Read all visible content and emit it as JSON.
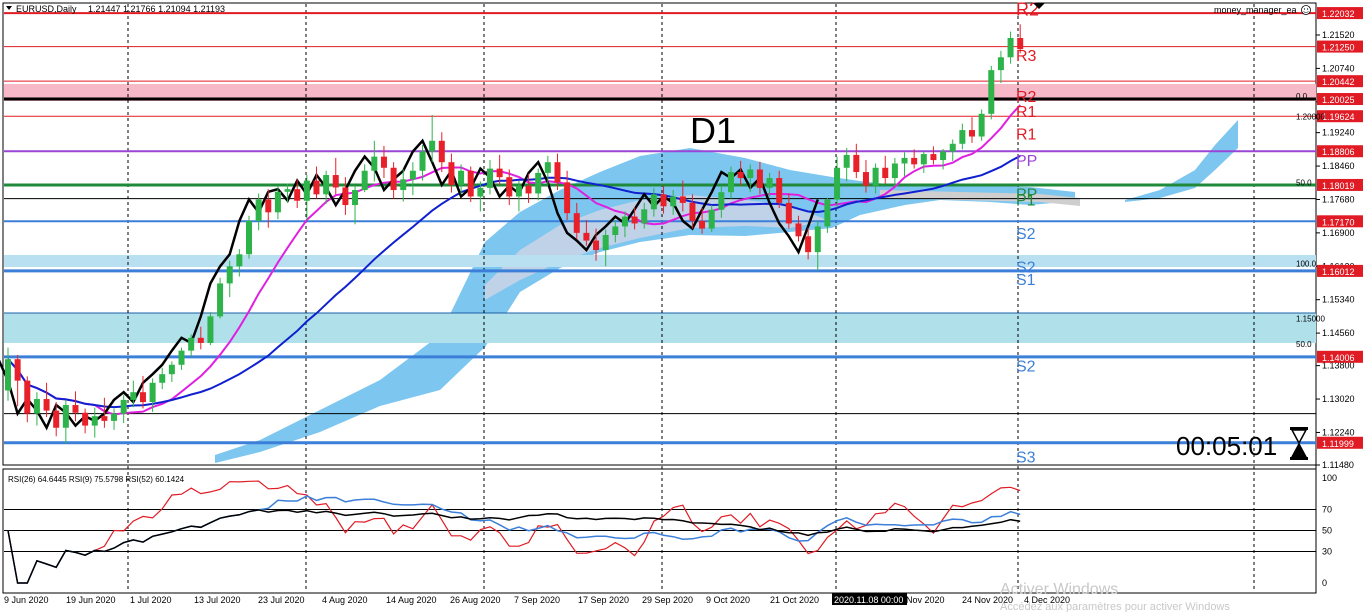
{
  "header": {
    "symbol": "EURUSD,Daily",
    "ohlc": "1.21447 1.21766 1.21094 1.21193",
    "ea_name": "money_manager_ea"
  },
  "timer": "00:05:01",
  "chart_title": "D1",
  "watermark": {
    "line1": "Activer Windows",
    "line2": "Accédez aux paramètres pour activer Windows"
  },
  "rsi_header": "RSI(26) 64.6445  RSI(9) 75.5798  RSI(52) 60.1424",
  "colors": {
    "bull": "#2db34a",
    "bear": "#e8202a",
    "ma_blue": "#1020d0",
    "ma_magenta": "#e020e0",
    "ma_black": "#000000",
    "cloud": "#7cc6f0",
    "level_red": "#e01b24",
    "level_blue": "#3b7fd9",
    "level_green": "#1f8a3a",
    "level_purple": "#9a45d6",
    "price_badge": "#e01b24"
  },
  "chart_data": {
    "type": "candlestick",
    "symbol": "EURUSD",
    "timeframe": "Daily",
    "ylim": [
      1.1148,
      1.2236
    ],
    "y_ticks": [
      1.2152,
      1.2074,
      1.1996,
      1.1924,
      1.1846,
      1.1768,
      1.169,
      1.1612,
      1.1534,
      1.1456,
      1.138,
      1.1302,
      1.1224,
      1.1148
    ],
    "x_tick_labels": [
      "9 Jun 2020",
      "19 Jun 2020",
      "1 Jul 2020",
      "13 Jul 2020",
      "23 Jul 2020",
      "4 Aug 2020",
      "14 Aug 2020",
      "26 Aug 2020",
      "7 Sep 2020",
      "17 Sep 2020",
      "29 Sep 2020",
      "9 Oct 2020",
      "21 Oct 2020",
      "2020.11.08 00:00",
      "Nov 2020",
      "24 Nov 2020",
      "4 Dec 2020"
    ],
    "candles": [
      {
        "o": 1.1322,
        "h": 1.1422,
        "l": 1.1298,
        "c": 1.1395
      },
      {
        "o": 1.1395,
        "h": 1.1405,
        "l": 1.1285,
        "c": 1.1345
      },
      {
        "o": 1.1345,
        "h": 1.1355,
        "l": 1.1248,
        "c": 1.1268
      },
      {
        "o": 1.1268,
        "h": 1.1318,
        "l": 1.124,
        "c": 1.1302
      },
      {
        "o": 1.1302,
        "h": 1.134,
        "l": 1.126,
        "c": 1.1275
      },
      {
        "o": 1.1275,
        "h": 1.1295,
        "l": 1.1215,
        "c": 1.1235
      },
      {
        "o": 1.1235,
        "h": 1.13,
        "l": 1.1198,
        "c": 1.1288
      },
      {
        "o": 1.1288,
        "h": 1.132,
        "l": 1.125,
        "c": 1.127
      },
      {
        "o": 1.127,
        "h": 1.128,
        "l": 1.1222,
        "c": 1.124
      },
      {
        "o": 1.124,
        "h": 1.1282,
        "l": 1.1212,
        "c": 1.1262
      },
      {
        "o": 1.1262,
        "h": 1.1305,
        "l": 1.1235,
        "c": 1.1251
      },
      {
        "o": 1.1251,
        "h": 1.128,
        "l": 1.123,
        "c": 1.1268
      },
      {
        "o": 1.1268,
        "h": 1.1312,
        "l": 1.1246,
        "c": 1.13
      },
      {
        "o": 1.13,
        "h": 1.1345,
        "l": 1.1283,
        "c": 1.1318
      },
      {
        "o": 1.1318,
        "h": 1.1356,
        "l": 1.128,
        "c": 1.1295
      },
      {
        "o": 1.1295,
        "h": 1.135,
        "l": 1.1272,
        "c": 1.134
      },
      {
        "o": 1.134,
        "h": 1.1375,
        "l": 1.1325,
        "c": 1.136
      },
      {
        "o": 1.136,
        "h": 1.139,
        "l": 1.1342,
        "c": 1.1382
      },
      {
        "o": 1.1382,
        "h": 1.1422,
        "l": 1.137,
        "c": 1.1415
      },
      {
        "o": 1.1415,
        "h": 1.1453,
        "l": 1.1402,
        "c": 1.1445
      },
      {
        "o": 1.1445,
        "h": 1.1471,
        "l": 1.1418,
        "c": 1.1433
      },
      {
        "o": 1.1433,
        "h": 1.1505,
        "l": 1.1428,
        "c": 1.1495
      },
      {
        "o": 1.1495,
        "h": 1.1585,
        "l": 1.149,
        "c": 1.1572
      },
      {
        "o": 1.1572,
        "h": 1.1625,
        "l": 1.154,
        "c": 1.1612
      },
      {
        "o": 1.1612,
        "h": 1.1652,
        "l": 1.1588,
        "c": 1.164
      },
      {
        "o": 1.164,
        "h": 1.173,
        "l": 1.163,
        "c": 1.1718
      },
      {
        "o": 1.1718,
        "h": 1.1782,
        "l": 1.1696,
        "c": 1.1768
      },
      {
        "o": 1.1768,
        "h": 1.1792,
        "l": 1.1702,
        "c": 1.1738
      },
      {
        "o": 1.1738,
        "h": 1.18,
        "l": 1.1722,
        "c": 1.1786
      },
      {
        "o": 1.1786,
        "h": 1.1805,
        "l": 1.176,
        "c": 1.1792
      },
      {
        "o": 1.1792,
        "h": 1.1815,
        "l": 1.1748,
        "c": 1.1765
      },
      {
        "o": 1.1765,
        "h": 1.1825,
        "l": 1.172,
        "c": 1.1812
      },
      {
        "o": 1.1812,
        "h": 1.1845,
        "l": 1.177,
        "c": 1.178
      },
      {
        "o": 1.178,
        "h": 1.1835,
        "l": 1.1758,
        "c": 1.1825
      },
      {
        "o": 1.1825,
        "h": 1.1865,
        "l": 1.178,
        "c": 1.1796
      },
      {
        "o": 1.1796,
        "h": 1.182,
        "l": 1.1732,
        "c": 1.1755
      },
      {
        "o": 1.1755,
        "h": 1.18,
        "l": 1.171,
        "c": 1.179
      },
      {
        "o": 1.179,
        "h": 1.185,
        "l": 1.1785,
        "c": 1.1835
      },
      {
        "o": 1.1835,
        "h": 1.1905,
        "l": 1.181,
        "c": 1.1868
      },
      {
        "o": 1.1868,
        "h": 1.1893,
        "l": 1.1818,
        "c": 1.1842
      },
      {
        "o": 1.1842,
        "h": 1.1855,
        "l": 1.177,
        "c": 1.179
      },
      {
        "o": 1.179,
        "h": 1.1838,
        "l": 1.1763,
        "c": 1.1815
      },
      {
        "o": 1.1815,
        "h": 1.1855,
        "l": 1.1778,
        "c": 1.1835
      },
      {
        "o": 1.1835,
        "h": 1.1895,
        "l": 1.1812,
        "c": 1.188
      },
      {
        "o": 1.188,
        "h": 1.1965,
        "l": 1.1855,
        "c": 1.1905
      },
      {
        "o": 1.1905,
        "h": 1.1925,
        "l": 1.1832,
        "c": 1.1855
      },
      {
        "o": 1.1855,
        "h": 1.1875,
        "l": 1.1784,
        "c": 1.1802
      },
      {
        "o": 1.1802,
        "h": 1.185,
        "l": 1.178,
        "c": 1.1835
      },
      {
        "o": 1.1835,
        "h": 1.1845,
        "l": 1.1762,
        "c": 1.1775
      },
      {
        "o": 1.1775,
        "h": 1.181,
        "l": 1.174,
        "c": 1.1795
      },
      {
        "o": 1.1795,
        "h": 1.186,
        "l": 1.178,
        "c": 1.184
      },
      {
        "o": 1.184,
        "h": 1.1872,
        "l": 1.1802,
        "c": 1.182
      },
      {
        "o": 1.182,
        "h": 1.1838,
        "l": 1.1755,
        "c": 1.1775
      },
      {
        "o": 1.1775,
        "h": 1.1812,
        "l": 1.174,
        "c": 1.18
      },
      {
        "o": 1.18,
        "h": 1.1828,
        "l": 1.176,
        "c": 1.1782
      },
      {
        "o": 1.1782,
        "h": 1.184,
        "l": 1.1766,
        "c": 1.183
      },
      {
        "o": 1.183,
        "h": 1.187,
        "l": 1.18,
        "c": 1.1855
      },
      {
        "o": 1.1855,
        "h": 1.1875,
        "l": 1.179,
        "c": 1.1808
      },
      {
        "o": 1.1808,
        "h": 1.1835,
        "l": 1.172,
        "c": 1.1736
      },
      {
        "o": 1.1736,
        "h": 1.176,
        "l": 1.1675,
        "c": 1.169
      },
      {
        "o": 1.169,
        "h": 1.172,
        "l": 1.166,
        "c": 1.1672
      },
      {
        "o": 1.1672,
        "h": 1.17,
        "l": 1.1625,
        "c": 1.165
      },
      {
        "o": 1.165,
        "h": 1.1698,
        "l": 1.1612,
        "c": 1.1685
      },
      {
        "o": 1.1685,
        "h": 1.172,
        "l": 1.1668,
        "c": 1.1705
      },
      {
        "o": 1.1705,
        "h": 1.174,
        "l": 1.168,
        "c": 1.1728
      },
      {
        "o": 1.1728,
        "h": 1.175,
        "l": 1.1698,
        "c": 1.1712
      },
      {
        "o": 1.1712,
        "h": 1.176,
        "l": 1.17,
        "c": 1.1745
      },
      {
        "o": 1.1745,
        "h": 1.1795,
        "l": 1.1728,
        "c": 1.178
      },
      {
        "o": 1.178,
        "h": 1.18,
        "l": 1.1735,
        "c": 1.1752
      },
      {
        "o": 1.1752,
        "h": 1.179,
        "l": 1.1732,
        "c": 1.1775
      },
      {
        "o": 1.1775,
        "h": 1.1812,
        "l": 1.174,
        "c": 1.176
      },
      {
        "o": 1.176,
        "h": 1.178,
        "l": 1.17,
        "c": 1.1718
      },
      {
        "o": 1.1718,
        "h": 1.1748,
        "l": 1.1688,
        "c": 1.17
      },
      {
        "o": 1.17,
        "h": 1.1755,
        "l": 1.1692,
        "c": 1.1744
      },
      {
        "o": 1.1744,
        "h": 1.18,
        "l": 1.1725,
        "c": 1.1785
      },
      {
        "o": 1.1785,
        "h": 1.1845,
        "l": 1.177,
        "c": 1.1832
      },
      {
        "o": 1.1832,
        "h": 1.1858,
        "l": 1.18,
        "c": 1.1818
      },
      {
        "o": 1.1818,
        "h": 1.185,
        "l": 1.1785,
        "c": 1.1838
      },
      {
        "o": 1.1838,
        "h": 1.1856,
        "l": 1.178,
        "c": 1.1795
      },
      {
        "o": 1.1795,
        "h": 1.183,
        "l": 1.1775,
        "c": 1.1818
      },
      {
        "o": 1.1818,
        "h": 1.1835,
        "l": 1.1748,
        "c": 1.176
      },
      {
        "o": 1.176,
        "h": 1.1782,
        "l": 1.17,
        "c": 1.1712
      },
      {
        "o": 1.1712,
        "h": 1.173,
        "l": 1.167,
        "c": 1.1682
      },
      {
        "o": 1.1682,
        "h": 1.1702,
        "l": 1.1628,
        "c": 1.1645
      },
      {
        "o": 1.1645,
        "h": 1.1718,
        "l": 1.1602,
        "c": 1.1705
      },
      {
        "o": 1.1705,
        "h": 1.1772,
        "l": 1.169,
        "c": 1.1768
      },
      {
        "o": 1.1768,
        "h": 1.1868,
        "l": 1.175,
        "c": 1.1842
      },
      {
        "o": 1.1842,
        "h": 1.1888,
        "l": 1.181,
        "c": 1.1872
      },
      {
        "o": 1.1872,
        "h": 1.1898,
        "l": 1.1818,
        "c": 1.1832
      },
      {
        "o": 1.1832,
        "h": 1.186,
        "l": 1.1784,
        "c": 1.18
      },
      {
        "o": 1.18,
        "h": 1.1852,
        "l": 1.1782,
        "c": 1.1842
      },
      {
        "o": 1.1842,
        "h": 1.187,
        "l": 1.1805,
        "c": 1.1818
      },
      {
        "o": 1.1818,
        "h": 1.1865,
        "l": 1.18,
        "c": 1.1852
      },
      {
        "o": 1.1852,
        "h": 1.1878,
        "l": 1.1822,
        "c": 1.1865
      },
      {
        "o": 1.1865,
        "h": 1.1885,
        "l": 1.184,
        "c": 1.185
      },
      {
        "o": 1.185,
        "h": 1.188,
        "l": 1.183,
        "c": 1.1874
      },
      {
        "o": 1.1874,
        "h": 1.1892,
        "l": 1.185,
        "c": 1.186
      },
      {
        "o": 1.186,
        "h": 1.1886,
        "l": 1.1838,
        "c": 1.188
      },
      {
        "o": 1.188,
        "h": 1.1908,
        "l": 1.1858,
        "c": 1.1898
      },
      {
        "o": 1.1898,
        "h": 1.1945,
        "l": 1.1885,
        "c": 1.193
      },
      {
        "o": 1.193,
        "h": 1.196,
        "l": 1.19,
        "c": 1.1915
      },
      {
        "o": 1.1915,
        "h": 1.1978,
        "l": 1.1905,
        "c": 1.1968
      },
      {
        "o": 1.1968,
        "h": 1.208,
        "l": 1.1955,
        "c": 1.207
      },
      {
        "o": 1.207,
        "h": 1.2115,
        "l": 1.204,
        "c": 1.21
      },
      {
        "o": 1.21,
        "h": 1.216,
        "l": 1.2085,
        "c": 1.2145
      },
      {
        "o": 1.2145,
        "h": 1.2177,
        "l": 1.2109,
        "c": 1.2119
      }
    ],
    "levels": [
      {
        "price": 1.22032,
        "label": "1.22032",
        "color": "#e01b24",
        "width": 2
      },
      {
        "price": 1.2125,
        "label": "1.21250",
        "color": "#e01b24",
        "width": 1
      },
      {
        "price": 1.20442,
        "label": "1.20442",
        "color": "#e01b24",
        "width": 1
      },
      {
        "price": 1.20025,
        "label": "1.20025",
        "color": "#000000",
        "width": 3
      },
      {
        "price": 1.19624,
        "label": "1.19624",
        "color": "#e01b24",
        "width": 1
      },
      {
        "price": 1.18806,
        "label": "1.18806",
        "color": "#9a45d6",
        "width": 2
      },
      {
        "price": 1.18019,
        "label": "1.18019",
        "color": "#1f8a3a",
        "width": 3
      },
      {
        "price": 1.1717,
        "label": "1.17170",
        "color": "#3b7fd9",
        "width": 2
      },
      {
        "price": 1.16012,
        "label": "1.16012",
        "color": "#3b7fd9",
        "width": 3
      },
      {
        "price": 1.14006,
        "label": "1.14006",
        "color": "#3b7fd9",
        "width": 3
      },
      {
        "price": 1.11999,
        "label": "1.11999",
        "color": "#3b7fd9",
        "width": 3
      }
    ],
    "pivot_labels": [
      {
        "text": "R2",
        "price": 1.2212,
        "color": "#e01b24"
      },
      {
        "text": "R3",
        "price": 1.2105,
        "color": "#e01b24"
      },
      {
        "text": "R2",
        "price": 1.201,
        "color": "#e01b24"
      },
      {
        "text": "R1",
        "price": 1.1975,
        "color": "#e01b24"
      },
      {
        "text": "R1",
        "price": 1.1922,
        "color": "#e01b24"
      },
      {
        "text": "PP",
        "price": 1.186,
        "color": "#9a45d6"
      },
      {
        "text": "PP",
        "price": 1.1782,
        "color": "#1f8a3a"
      },
      {
        "text": "P1",
        "price": 1.1768,
        "color": "#1f8a3a"
      },
      {
        "text": "S2",
        "price": 1.169,
        "color": "#3b7fd9"
      },
      {
        "text": "S2",
        "price": 1.1612,
        "color": "#3b7fd9"
      },
      {
        "text": "S1",
        "price": 1.1582,
        "color": "#3b7fd9"
      },
      {
        "text": "S2",
        "price": 1.138,
        "color": "#3b7fd9"
      },
      {
        "text": "S3",
        "price": 1.1168,
        "color": "#3b7fd9"
      }
    ],
    "side_labels": [
      {
        "text": "1.20000",
        "price": 1.1962
      },
      {
        "text": "0.0",
        "price": 1.201
      },
      {
        "text": "50.0",
        "price": 1.1808
      },
      {
        "text": "100.0",
        "price": 1.1618
      },
      {
        "text": "1.15000",
        "price": 1.149
      },
      {
        "text": "50.0",
        "price": 1.143
      }
    ],
    "rsi": {
      "ylim": [
        0,
        100
      ],
      "ticks": [
        100,
        70,
        50,
        30,
        0
      ],
      "levels": [
        70,
        50,
        30
      ],
      "series": [
        {
          "name": "RSI(26)",
          "last": 64.6445
        },
        {
          "name": "RSI(9)",
          "last": 75.5798
        },
        {
          "name": "RSI(52)",
          "last": 60.1424
        }
      ]
    }
  }
}
